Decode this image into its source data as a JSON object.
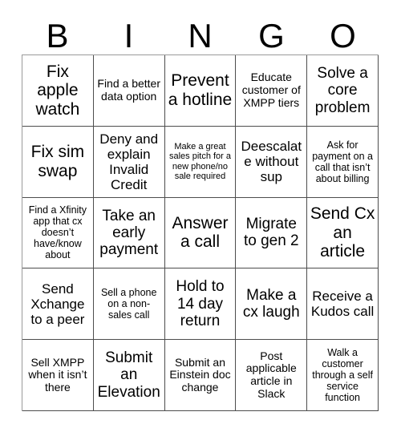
{
  "header": {
    "letters": [
      "B",
      "I",
      "N",
      "G",
      "O"
    ]
  },
  "grid": {
    "columns": 5,
    "rows": 5,
    "cells": [
      {
        "text": "Fix apple watch",
        "size": "fs-xl"
      },
      {
        "text": "Find a better data option",
        "size": "fs-sm"
      },
      {
        "text": "Prevent a hotline",
        "size": "fs-xl"
      },
      {
        "text": "Educate customer of XMPP tiers",
        "size": "fs-sm"
      },
      {
        "text": "Solve a core problem",
        "size": "fs-lg"
      },
      {
        "text": "Fix sim swap",
        "size": "fs-xl"
      },
      {
        "text": "Deny and explain Invalid Credit",
        "size": "fs-md"
      },
      {
        "text": "Make a great sales pitch for a new phone/no sale required",
        "size": "fs-xxs"
      },
      {
        "text": "Deescalate without sup",
        "size": "fs-md"
      },
      {
        "text": "Ask for payment on a call that isn’t about billing",
        "size": "fs-xs"
      },
      {
        "text": "Find a Xfinity app that cx doesn’t have/know about",
        "size": "fs-xs"
      },
      {
        "text": "Take an early payment",
        "size": "fs-lg"
      },
      {
        "text": "Answer a call",
        "size": "fs-xl"
      },
      {
        "text": "Migrate to gen 2",
        "size": "fs-lg"
      },
      {
        "text": "Send Cx an article",
        "size": "fs-xl"
      },
      {
        "text": "Send Xchange to a peer",
        "size": "fs-md"
      },
      {
        "text": "Sell a phone on a non-sales call",
        "size": "fs-xs"
      },
      {
        "text": "Hold to 14 day return",
        "size": "fs-lg"
      },
      {
        "text": "Make a cx laugh",
        "size": "fs-lg"
      },
      {
        "text": "Receive a Kudos call",
        "size": "fs-md"
      },
      {
        "text": "Sell XMPP when it isn’t there",
        "size": "fs-sm"
      },
      {
        "text": "Submit an Elevation",
        "size": "fs-lg"
      },
      {
        "text": "Submit an Einstein doc change",
        "size": "fs-sm"
      },
      {
        "text": "Post applicable article in Slack",
        "size": "fs-sm"
      },
      {
        "text": "Walk a customer through a self service function",
        "size": "fs-xs"
      }
    ]
  },
  "colors": {
    "background": "#ffffff",
    "text": "#000000",
    "grid_line": "#4d4d4d"
  }
}
